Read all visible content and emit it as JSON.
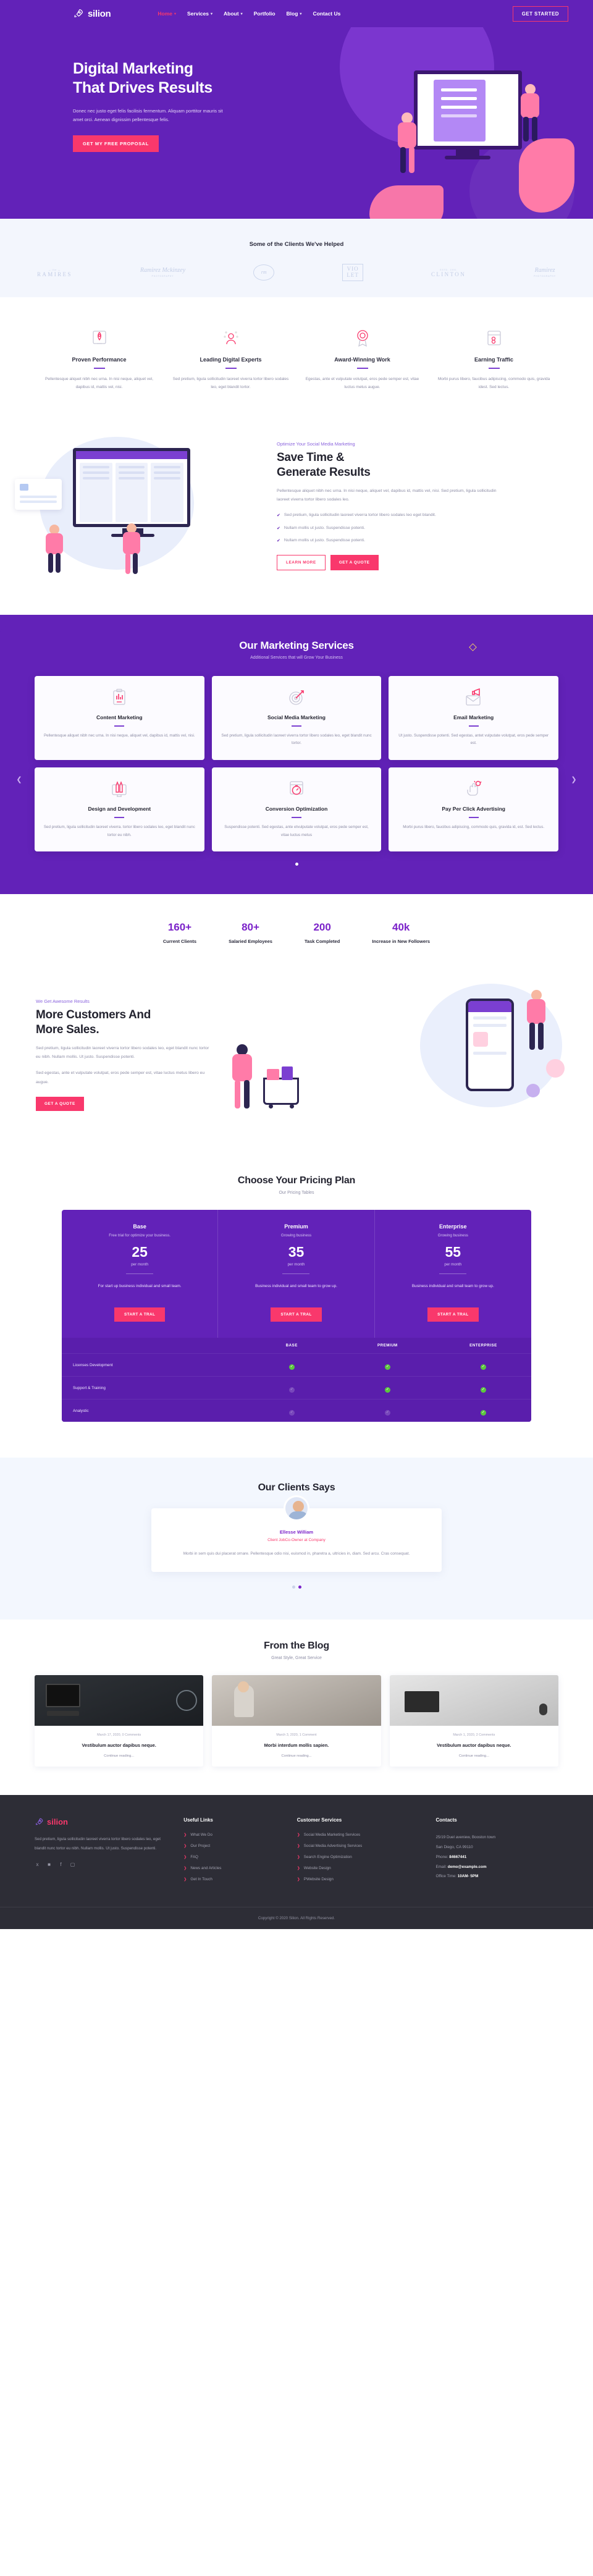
{
  "brand": {
    "name": "silion",
    "icon": "rocket-icon"
  },
  "nav": {
    "items": [
      {
        "label": "Home",
        "caret": "⌄",
        "active": true
      },
      {
        "label": "Services",
        "caret": "⌄",
        "active": false
      },
      {
        "label": "About",
        "caret": "⌄",
        "active": false
      },
      {
        "label": "Portfolio",
        "caret": "",
        "active": false
      },
      {
        "label": "Blog",
        "caret": "⌄",
        "active": false
      },
      {
        "label": "Contact Us",
        "caret": "",
        "active": false
      }
    ],
    "cta": "GET STARTED"
  },
  "hero": {
    "title_line1": "Digital Marketing",
    "title_line2": "That Drives Results",
    "subtitle": "Donec nec justo eget felis facilisis fermentum. Aliquam porttitor mauris sit amet orci. Aenean dignissim pellentesque felis.",
    "cta": "GET MY FREE PROPOSAL"
  },
  "clients": {
    "title": "Some of the Clients We've Helped",
    "logos": [
      {
        "name": "RAMIRES",
        "tiny": "— the —"
      },
      {
        "name": "Ramirez Mckinzey",
        "tiny": "PHOTOGRAPHY"
      },
      {
        "name": "rm",
        "tiny": "1989"
      },
      {
        "name": "VIO LET",
        "tiny": ""
      },
      {
        "name": "CLINTON",
        "tiny": "ESTD. 1991"
      },
      {
        "name": "Ramirez",
        "tiny": "PHOTOGRAPHY"
      }
    ]
  },
  "features": [
    {
      "icon": "rocket-launch-icon",
      "title": "Proven Performance",
      "text": "Pellentesque aliquet nibh nec urna. In nisi neque, aliquet vel, dapibus id, mattis vel, nisi."
    },
    {
      "icon": "expert-person-icon",
      "title": "Leading Digital Experts",
      "text": "Sed pretium, ligula sollicitudin laoreet viverra tortor libero sodales leo, eget blandit tortor."
    },
    {
      "icon": "award-badge-icon",
      "title": "Award-Winning Work",
      "text": "Egestas, ante et vulputate volutpat, eros pede semper est, vitae luctus metus augue."
    },
    {
      "icon": "traffic-window-icon",
      "title": "Earning Traffic",
      "text": "Morbi purus libero, faucibus adipiscing, commodo quis, gravida idest. Sed lectus."
    }
  ],
  "savetime": {
    "eyebrow": "Optimize Your Social Media Marketing",
    "title_line1": "Save Time &",
    "title_line2": "Generate Results",
    "paragraph": "Pellentesque aliquet nibh nec urna. In nisi neque, aliquet vel, dapibus id, mattis vel, nisi. Sed pretium, ligula sollicitudin laoreet viverra tortor libero sodales leo.",
    "checks": [
      "Sed pretium, ligula sollicitudin laoreet viverra tortor libero sodales leo eget blandit.",
      "Nullam mollis ut justo. Suspendisse potenti.",
      "Nullam mollis ut justo. Suspendisse potenti."
    ],
    "btn_outline": "LEARN MORE",
    "btn_solid": "GET A QUOTE"
  },
  "services": {
    "title": "Our Marketing Services",
    "subtitle": "Additional Services that will Grow Your Business",
    "cards": [
      {
        "icon": "content-clipboard-chart-icon",
        "title": "Content Marketing",
        "text": "Pellentesque aliquet nibh nec urna. In nisi neque, aliquet vel, dapibus id, mattis vel, nisi."
      },
      {
        "icon": "target-dart-icon",
        "title": "Social Media Marketing",
        "text": "Sed pretium, ligula sollicitudin laoreet viverra tortor libero sodales leo, eget blandit nunc tortor."
      },
      {
        "icon": "email-megaphone-icon",
        "title": "Email Marketing",
        "text": "Ut justo. Suspendisse potenti. Sed egestas, antet vulputate volutpat, eros pede semper est."
      },
      {
        "icon": "design-pencils-monitor-icon",
        "title": "Design and Development",
        "text": "Sed pretium, ligula sollicitudin laoreet viverra. tortor libero sodales leo, eget blandit nunc tortor eu nibh."
      },
      {
        "icon": "conversion-stopwatch-icon",
        "title": "Conversion Optimization",
        "text": "Suspendisse potenti. Sed egestas, ante etvulputate volutpat, eros pede semper est, vitae luctus metus"
      },
      {
        "icon": "click-cursor-icon",
        "title": "Pay Per Click Advertising",
        "text": "Morbi purus libero, faucibus adipiscing, commodo quis, gravida id, est. Sed lectus."
      }
    ],
    "prev_icon": "chevron-left-icon",
    "next_icon": "chevron-right-icon"
  },
  "stats": [
    {
      "number": "160+",
      "label": "Current Clients"
    },
    {
      "number": "80+",
      "label": "Salaried Employees"
    },
    {
      "number": "200",
      "label": "Task Completed"
    },
    {
      "number": "40k",
      "label": "Increase in New Followers"
    }
  ],
  "more": {
    "eyebrow": "We Get Awesome Results",
    "title_line1": "More Customers And",
    "title_line2": "More Sales.",
    "p1": "Sed pretium, ligula sollicitudin laoreet viverra tortor libero sodales leo, eget blandit nunc tortor eu nibh. Nullam mollis. Ut justo. Suspendisse potenti.",
    "p2": "Sed egestas, ante et vulputate volutpat, eros pede semper est, vitae luctus metus libero eu augue.",
    "cta": "GET A QUOTE"
  },
  "pricing": {
    "title": "Choose Your Pricing Plan",
    "subtitle": "Our Pricing Tables",
    "plans": [
      {
        "name": "Base",
        "desc": "Free trial for optimize your business.",
        "amount": "25",
        "per": "per month",
        "note": "For start up business individual and small team.",
        "cta": "START A TRAL"
      },
      {
        "name": "Premium",
        "desc": "Growing business",
        "amount": "35",
        "per": "per month",
        "note": "Business individual and small team to grow up.",
        "cta": "START A TRAL"
      },
      {
        "name": "Enterprise",
        "desc": "Growing business",
        "amount": "55",
        "per": "per month",
        "note": "Business individual and small team to grow up.",
        "cta": "START A TRAL"
      }
    ],
    "table": {
      "columns": [
        "",
        "BASE",
        "PREMIUM",
        "ENTERPRISE"
      ],
      "rows": [
        {
          "feature": "Licenses Development",
          "values": [
            true,
            true,
            true
          ]
        },
        {
          "feature": "Support & Training",
          "values": [
            false,
            true,
            true
          ]
        },
        {
          "feature": "Analystic",
          "values": [
            false,
            false,
            true
          ]
        }
      ]
    }
  },
  "testimonial": {
    "title": "Our Clients Says",
    "name": "Ellesse William",
    "role": "Client JobCo-Owner at Company",
    "text": "Morbi in sem quis dui placerat ornare. Pellentesque odio nisi, euismod in, pharetra a, ultricies in, diam. Sed arcu. Cras consequat.",
    "dots": 2,
    "active_dot": 1
  },
  "blog": {
    "title": "From the Blog",
    "subtitle": "Great Style, Great Service",
    "posts": [
      {
        "meta": "March 17, 2020, 0 Comments",
        "title": "Vestibulum auctor dapibus neque.",
        "more": "Continue reading..."
      },
      {
        "meta": "March 3, 2020, 1 Comment",
        "title": "Morbi interdum mollis sapien.",
        "more": "Continue reading..."
      },
      {
        "meta": "March 1, 2020, 2 Comments",
        "title": "Vestibulum auctor dapibus neque.",
        "more": "Continue reading..."
      }
    ]
  },
  "footer": {
    "brand": "silion",
    "about": "Sed pretium, ligula sollicitudin laoreet viverra tortor libero sodales leo, eget blandit nunc tortor eu nibh. Nullam mollis. Ut justo. Suspendisse potenti.",
    "social": [
      "twitter-icon",
      "linkedin-icon",
      "facebook-icon",
      "instagram-icon"
    ],
    "useful_links": {
      "heading": "Useful Links",
      "items": [
        "What We Do",
        "Our Project",
        "FAQ",
        "News and Articles",
        "Get In Touch"
      ]
    },
    "customer_services": {
      "heading": "Customer Services",
      "items": [
        "Social Media Marketing Services",
        "Social Media Advertising Services",
        "Search Engine Optimization",
        "Website Design",
        "PWebsite Design"
      ]
    },
    "contacts": {
      "heading": "Contacts",
      "address1": "25/19 Duel aveniew, Booston town",
      "address2": "San Diego, CA 99110",
      "phone_label": "Phone:",
      "phone": "84667441",
      "email_label": "Email:",
      "email": "demo@example.com",
      "hours_label": "Office Time:",
      "hours": "10AM- 5PM"
    },
    "copyright": "Copyright © 2020 Silion. All Rights Reserved."
  }
}
